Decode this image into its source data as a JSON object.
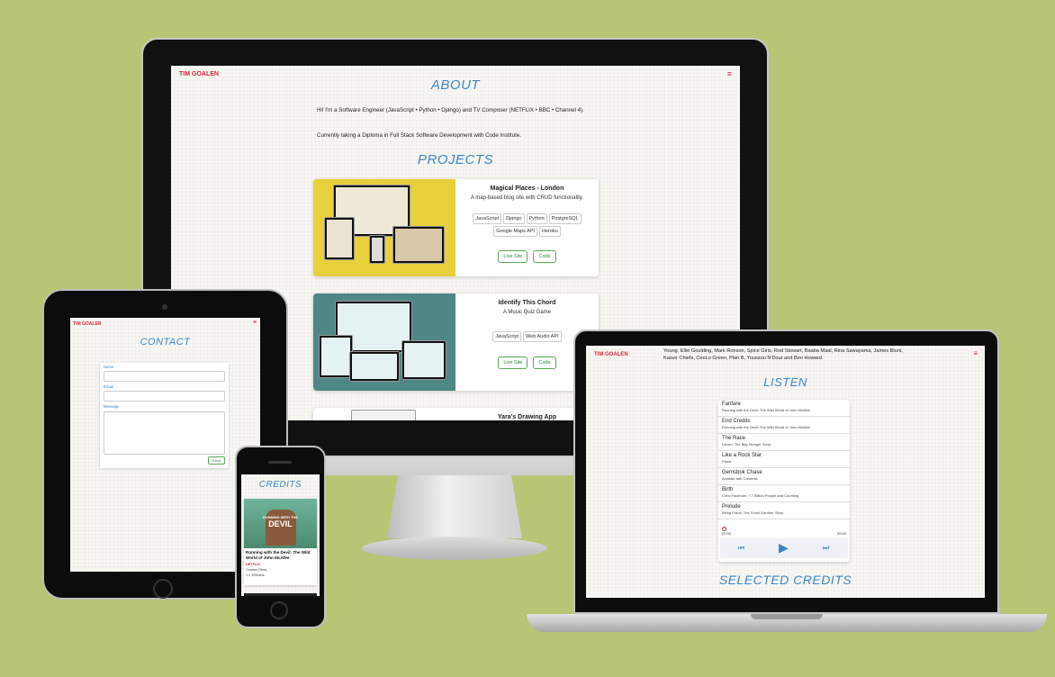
{
  "imac": {
    "brand": "TIM GOALEN",
    "about_heading": "ABOUT",
    "about_p1": "Hi! I'm a Software Engineer (JavaScript • Python • Django) and TV Composer (NETFLIX • BBC • Channel 4).",
    "about_p2": "Currently taking a Diploma in Full Stack Software Development with Code Institute.",
    "projects_heading": "PROJECTS",
    "projects": [
      {
        "title": "Magical Places - London",
        "subtitle": "A map-based blog site with CRUD functionality.",
        "tags": [
          "JavaScript",
          "Django",
          "Python",
          "PostgreSQL",
          "Google Maps API",
          "Heroku"
        ],
        "live_label": "Live Site",
        "code_label": "Code",
        "image_color": "#e8cf3c"
      },
      {
        "title": "Identify This Chord",
        "subtitle": "A Music Quiz Game",
        "tags": [
          "JavaScript",
          "Web Audio API"
        ],
        "live_label": "Live Site",
        "code_label": "Code",
        "image_color": "#4f8786"
      },
      {
        "title": "Yara's Drawing App"
      }
    ]
  },
  "ipad": {
    "brand": "TIM GOALEN",
    "contact_heading": "CONTACT",
    "name_label": "Name",
    "email_label": "Email",
    "message_label": "Message",
    "send_label": "Send"
  },
  "iphone": {
    "credits_heading": "CREDITS",
    "poster_text_1": "RUNNING WITH THE",
    "poster_text_2": "DEVIL",
    "credit_title": "Running with the Devil: The Wild World of John McAfee",
    "credit_network": "NETFLIX",
    "credit_company": "Curious Films",
    "credit_duration": "1 x 105mins"
  },
  "macbook": {
    "brand": "TIM GOALEN",
    "intro_text": "Young, Ellie Goulding, Mark Ronson, Spice Girls, Rod Stewart, Baaba Maal, Rina Sawayama, James Blunt, Kaiser Chiefs, CeeLo Green, Plan B, Youssou N'Dour and Ben Howard.",
    "listen_heading": "LISTEN",
    "tracks": [
      {
        "title": "Fanfare",
        "source": "Running with the Devil: The Wild World of John McAfee"
      },
      {
        "title": "End Credits",
        "source": "Running with the Devil: The Wild World of John McAfee"
      },
      {
        "title": "The Race",
        "source": "Driven: The Billy Monger Story"
      },
      {
        "title": "Like a Rock Star",
        "source": "Paula"
      },
      {
        "title": "Gemsbok Chase",
        "source": "Animals with Cameras"
      },
      {
        "title": "Birth",
        "source": "Chris Packham: 7.7 Billion People and Counting"
      },
      {
        "title": "Prelude",
        "source": "Being Frank: The Frank Gardner Story"
      }
    ],
    "time_current": "00:00",
    "time_total": "00:00",
    "progress": 0,
    "selected_credits_heading": "SELECTED CREDITS"
  },
  "colors": {
    "background": "#b7c575",
    "accent_red": "#d7263d",
    "heading_blue": "#3b86c6",
    "button_green": "#2e8b3e"
  }
}
